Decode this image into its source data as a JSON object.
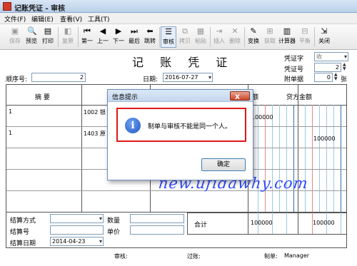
{
  "window": {
    "title": "记账凭证 - 审核"
  },
  "menu": {
    "items": [
      "文件(F)",
      "编辑(E)",
      "查看(V)",
      "工具(T)"
    ]
  },
  "toolbar": {
    "buttons": [
      {
        "label": "保存",
        "icon": "save-icon"
      },
      {
        "label": "预览",
        "icon": "preview-icon"
      },
      {
        "label": "打印",
        "icon": "print-icon"
      },
      {
        "label": "复原",
        "icon": "restore-icon"
      },
      {
        "label": "第一",
        "icon": "first-icon"
      },
      {
        "label": "上一",
        "icon": "prev-icon"
      },
      {
        "label": "下一",
        "icon": "next-icon"
      },
      {
        "label": "最后",
        "icon": "last-icon"
      },
      {
        "label": "跳转",
        "icon": "goto-icon"
      },
      {
        "label": "审核",
        "icon": "audit-icon"
      },
      {
        "label": "拷贝",
        "icon": "copy-icon"
      },
      {
        "label": "粘贴",
        "icon": "paste-icon"
      },
      {
        "label": "插入",
        "icon": "insert-icon"
      },
      {
        "label": "删除",
        "icon": "delete-icon"
      },
      {
        "label": "变换",
        "icon": "transform-icon"
      },
      {
        "label": "获取",
        "icon": "fetch-icon"
      },
      {
        "label": "计算器",
        "icon": "calculator-icon"
      },
      {
        "label": "平衡",
        "icon": "balance-icon"
      },
      {
        "label": "关闭",
        "icon": "close-door-icon"
      }
    ]
  },
  "voucher": {
    "title": "记 账 凭 证",
    "seq_label": "顺序号:",
    "seq_value": "2",
    "date_label": "日期:",
    "date_value": "2016-07-27",
    "type_label": "凭证字",
    "type_value": "收",
    "number_label": "凭证号",
    "number_value": "2",
    "attach_label": "附单据",
    "attach_value": "0",
    "attach_unit": "张"
  },
  "grid": {
    "headers": {
      "summary": "摘  要",
      "credit": "贷方金额",
      "debit_partial": "额"
    },
    "rows": [
      {
        "summary": "1",
        "account": "1002 银",
        "debit": "100000",
        "credit": ""
      },
      {
        "summary": "1",
        "account": "1403 原",
        "debit": "",
        "credit": "100000"
      }
    ]
  },
  "bottom": {
    "settle_type_label": "结算方式",
    "qty_label": "数量",
    "settle_no_label": "结算号",
    "price_label": "单价",
    "settle_date_label": "结算日期",
    "settle_date_value": "2014-04-23",
    "total_label": "合计",
    "total_debit": "100000",
    "total_credit": "100000"
  },
  "status": {
    "audit_label": "审核:",
    "post_label": "过账:",
    "maker_label": "制单:",
    "maker_value": "Manager"
  },
  "watermark": "new.ufidawhy.com",
  "dialog": {
    "title": "信息提示",
    "close_label": "X",
    "message": "制单与审核不能是同一个人。",
    "ok_label": "确定",
    "highlight_color": "#e01818"
  }
}
